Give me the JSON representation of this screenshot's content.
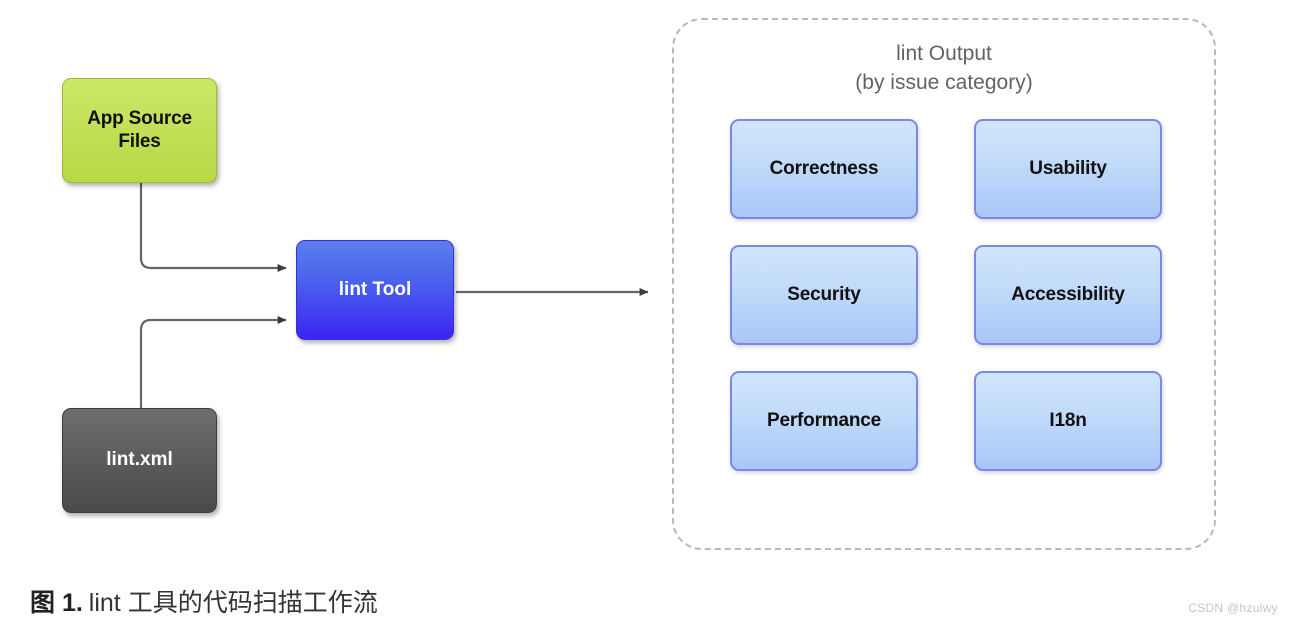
{
  "diagram": {
    "nodes": {
      "source": {
        "label": "App Source\nFiles",
        "color": "#c2e158"
      },
      "config": {
        "label": "lint.xml",
        "color": "#5d5d5d"
      },
      "tool": {
        "label": "lint Tool",
        "color": "#4a63ec"
      }
    },
    "output_panel": {
      "title_line1": "lint Output",
      "title_line2": "(by issue category)",
      "title": "lint Output\n(by issue category)",
      "border_color": "#b9b9b9",
      "categories": [
        {
          "label": "Correctness"
        },
        {
          "label": "Usability"
        },
        {
          "label": "Security"
        },
        {
          "label": "Accessibility"
        },
        {
          "label": "Performance"
        },
        {
          "label": "I18n"
        }
      ],
      "category_fill": "#c3dcfa",
      "category_border": "#7c88e8"
    },
    "connectors": [
      {
        "name": "source-to-tool",
        "from": "App Source Files",
        "to": "lint Tool"
      },
      {
        "name": "config-to-tool",
        "from": "lint.xml",
        "to": "lint Tool"
      },
      {
        "name": "tool-to-output",
        "from": "lint Tool",
        "to": "lint Output"
      }
    ]
  },
  "caption": {
    "figure_label": "图 1.",
    "figure_text": "lint 工具的代码扫描工作流"
  },
  "watermark": {
    "text": "CSDN @hzulwy"
  }
}
